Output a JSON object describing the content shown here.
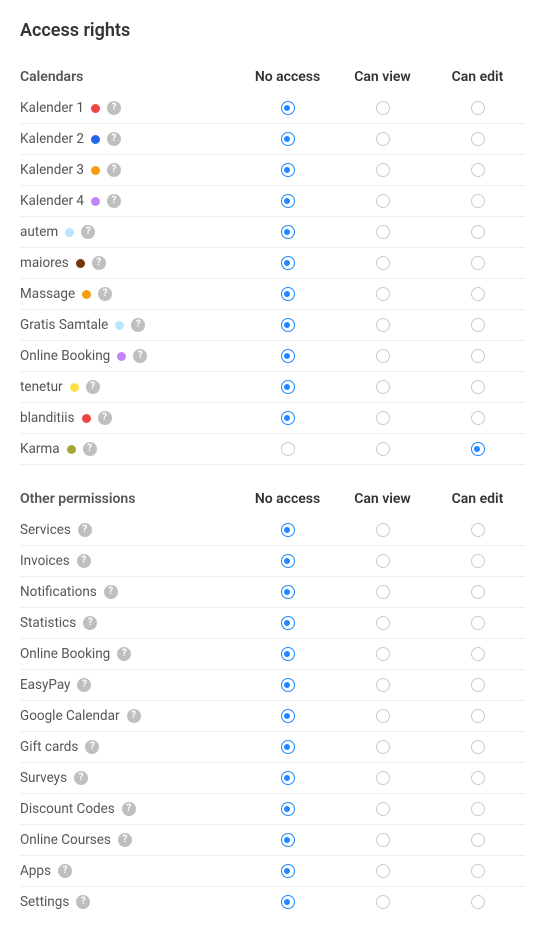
{
  "page_title": "Access rights",
  "columns": {
    "no_access": "No access",
    "can_view": "Can view",
    "can_edit": "Can edit"
  },
  "sections": [
    {
      "title": "Calendars",
      "rows": [
        {
          "label": "Kalender 1",
          "color": "#ef4444",
          "help": true,
          "selected": 0
        },
        {
          "label": "Kalender 2",
          "color": "#2563eb",
          "help": true,
          "selected": 0
        },
        {
          "label": "Kalender 3",
          "color": "#f59e0b",
          "help": true,
          "selected": 0
        },
        {
          "label": "Kalender 4",
          "color": "#c084fc",
          "help": true,
          "selected": 0
        },
        {
          "label": "autem",
          "color": "#bae6fd",
          "help": true,
          "selected": 0
        },
        {
          "label": "maiores",
          "color": "#78350f",
          "help": true,
          "selected": 0
        },
        {
          "label": "Massage",
          "color": "#f59e0b",
          "help": true,
          "selected": 0
        },
        {
          "label": "Gratis Samtale",
          "color": "#bae6fd",
          "help": true,
          "selected": 0
        },
        {
          "label": "Online Booking",
          "color": "#c084fc",
          "help": true,
          "selected": 0
        },
        {
          "label": "tenetur",
          "color": "#fde047",
          "help": true,
          "selected": 0
        },
        {
          "label": "blanditiis",
          "color": "#ef4444",
          "help": true,
          "selected": 0
        },
        {
          "label": "Karma",
          "color": "#a3a635",
          "help": true,
          "selected": 2
        }
      ]
    },
    {
      "title": "Other permissions",
      "rows": [
        {
          "label": "Services",
          "help": true,
          "selected": 0
        },
        {
          "label": "Invoices",
          "help": true,
          "selected": 0
        },
        {
          "label": "Notifications",
          "help": true,
          "selected": 0
        },
        {
          "label": "Statistics",
          "help": true,
          "selected": 0
        },
        {
          "label": "Online Booking",
          "help": true,
          "selected": 0
        },
        {
          "label": "EasyPay",
          "help": true,
          "selected": 0
        },
        {
          "label": "Google Calendar",
          "help": true,
          "selected": 0
        },
        {
          "label": "Gift cards",
          "help": true,
          "selected": 0
        },
        {
          "label": "Surveys",
          "help": true,
          "selected": 0
        },
        {
          "label": "Discount Codes",
          "help": true,
          "selected": 0
        },
        {
          "label": "Online Courses",
          "help": true,
          "selected": 0
        },
        {
          "label": "Apps",
          "help": true,
          "selected": 0
        },
        {
          "label": "Settings",
          "help": true,
          "selected": 0
        }
      ]
    }
  ]
}
